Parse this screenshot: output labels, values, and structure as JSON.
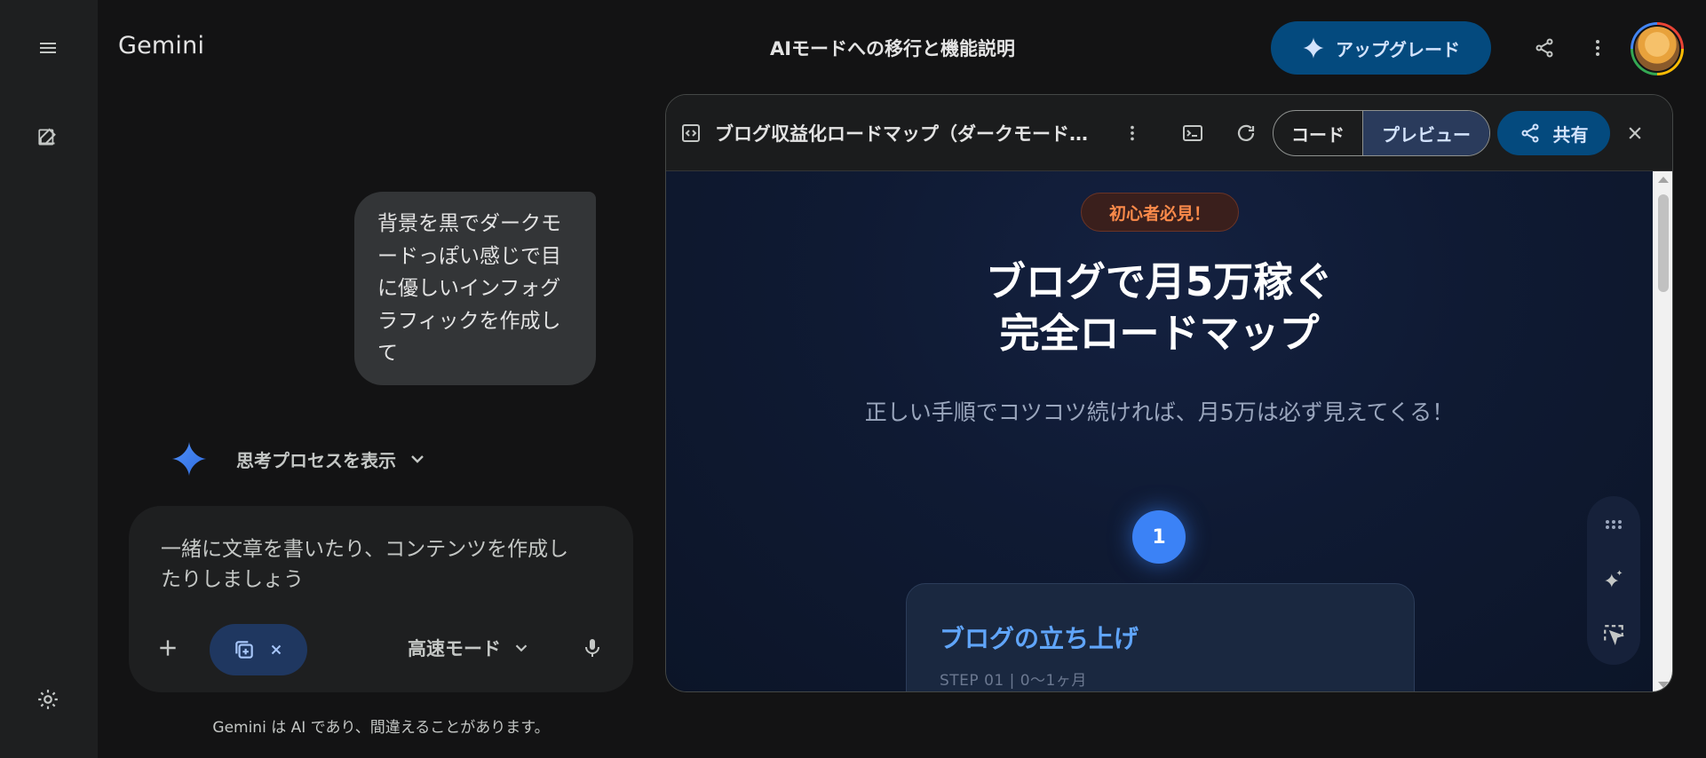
{
  "app": {
    "brand": "Gemini",
    "chat_title": "AIモードへの移行と機能説明"
  },
  "header": {
    "upgrade_label": "アップグレード"
  },
  "conversation": {
    "user_message": "背景を黒でダークモードっぽい感じで目に優しいインフォグラフィックを作成して",
    "thinking_label": "思考プロセスを表示"
  },
  "composer": {
    "placeholder": "一緒に文章を書いたり、コンテンツを作成したりしましょう",
    "mode_label": "高速モード"
  },
  "disclaimer": "Gemini は AI であり、間違えることがあります。",
  "canvas": {
    "title": "ブログ収益化ロードマップ（ダークモード...",
    "tabs": {
      "code": "コード",
      "preview": "プレビュー"
    },
    "share_label": "共有",
    "preview": {
      "badge": "初心者必見！",
      "title_line1": "ブログで月5万稼ぐ",
      "title_line2": "完全ロードマップ",
      "subtitle": "正しい手順でコツコツ続ければ、月5万は必ず見えてくる！",
      "step_number": "1",
      "step_title": "ブログの立ち上げ",
      "step_meta": "STEP 01 | 0〜1ヶ月"
    }
  },
  "colors": {
    "accent": "#044a7e",
    "step_blue": "#3b82f6",
    "badge_orange": "#fb8a4a"
  }
}
